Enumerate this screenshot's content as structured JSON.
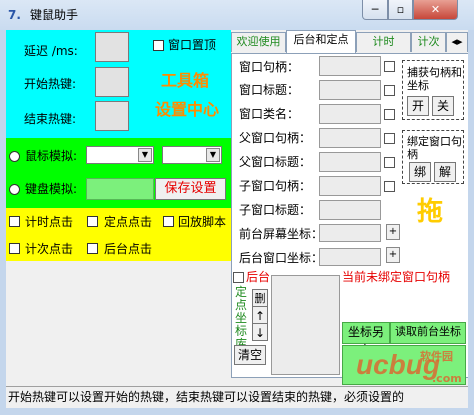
{
  "window": {
    "title": "键鼠助手",
    "app_icon": "7.",
    "min_label": "─",
    "max_label": "▫",
    "close_label": "✕"
  },
  "left": {
    "delay_label": "延迟 /ms:",
    "topmost_label": "窗口置顶",
    "start_hotkey_label": "开始热键:",
    "end_hotkey_label": "结束热键:",
    "toolbox_title": "工具箱",
    "settings_center": "设置中心",
    "mouse_sim_label": "鼠标模拟:",
    "keyboard_sim_label": "键盘模拟:",
    "save_settings": "保存设置",
    "timed_click": "计时点击",
    "fixed_point_click": "定点点击",
    "replay_script": "回放脚本",
    "count_click": "计次点击",
    "background_click": "后台点击",
    "colors": {
      "cyan": "#00ffff",
      "green": "#00ff00",
      "yellow": "#ffff00"
    }
  },
  "tabs": [
    {
      "label": "欢迎使用",
      "active": false
    },
    {
      "label": "后台和定点",
      "active": true
    },
    {
      "label": "计时",
      "active": false
    },
    {
      "label": "计次",
      "active": false
    }
  ],
  "tab_scroll": "◂▸",
  "panel": {
    "window_handle": "窗口句柄：",
    "window_title": "窗口标题：",
    "window_class": "窗口类名：",
    "parent_handle": "父窗口句柄：",
    "parent_title": "父窗口标题：",
    "child_handle": "子窗口句柄：",
    "child_title": "子窗口标题：",
    "fg_screen_coord": "前台屏幕坐标：",
    "bg_window_coord": "后台窗口坐标：",
    "capture_group": "捕获句柄和坐标",
    "open_btn": "开",
    "close_btn": "关",
    "bind_group": "绑定窗口句柄",
    "bind_btn": "绑",
    "unbind_btn": "解",
    "drag_label": "拖",
    "plus": "+",
    "background_cb": "后台",
    "unbound_notice": "当前未绑定窗口句柄",
    "coord_lib": "定点坐标库",
    "delete_btn": "删",
    "up_btn": "↑",
    "down_btn": "↓",
    "clear_btn": "清空",
    "save_coord_as": "坐标另存",
    "read_bg_coord": "读取前台坐标"
  },
  "status_text": "开始热键可以设置开始的热键，结束热键可以设置结束的热键，必须设置的",
  "watermark": {
    "main": "ucbug",
    "sub": "软件园",
    "dotcom": ".com"
  }
}
